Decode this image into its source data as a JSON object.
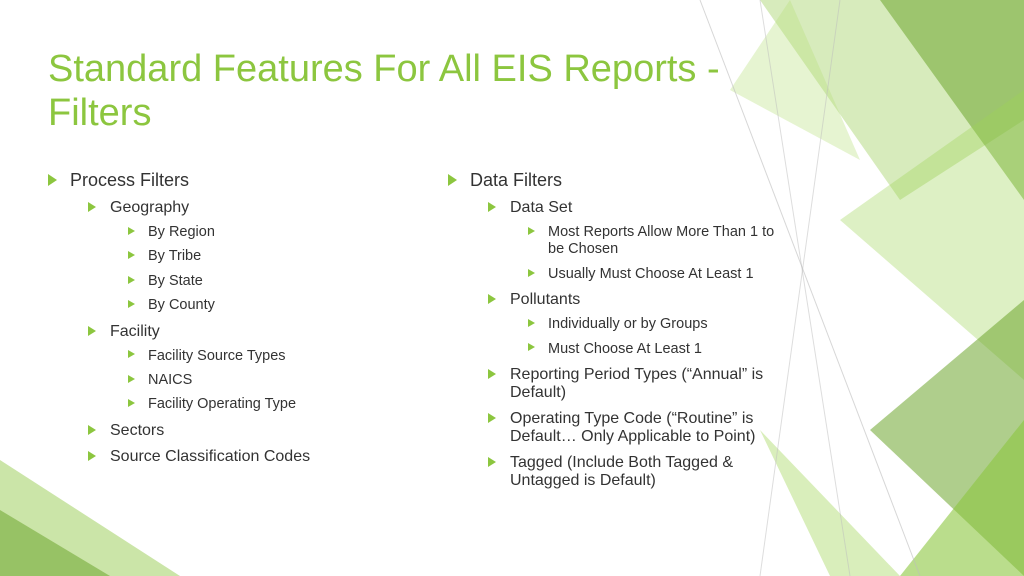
{
  "title": "Standard Features For All EIS Reports - Filters",
  "colors": {
    "accent": "#8CC63F"
  },
  "left": {
    "heading": "Process Filters",
    "items": [
      {
        "label": "Geography",
        "children": [
          "By Region",
          "By Tribe",
          "By State",
          "By County"
        ]
      },
      {
        "label": "Facility",
        "children": [
          "Facility Source Types",
          "NAICS",
          "Facility Operating Type"
        ]
      },
      {
        "label": "Sectors",
        "children": []
      },
      {
        "label": "Source Classification Codes",
        "children": []
      }
    ]
  },
  "right": {
    "heading": "Data Filters",
    "items": [
      {
        "label": "Data Set",
        "children": [
          "Most Reports Allow More Than 1 to be Chosen",
          "Usually Must Choose At Least 1"
        ]
      },
      {
        "label": "Pollutants",
        "children": [
          "Individually or by Groups",
          "Must Choose At Least 1"
        ]
      },
      {
        "label": "Reporting Period Types (“Annual” is Default)",
        "children": []
      },
      {
        "label": "Operating Type Code (“Routine” is Default…  Only Applicable to Point)",
        "children": []
      },
      {
        "label": "Tagged (Include Both Tagged & Untagged is Default)",
        "children": []
      }
    ]
  }
}
